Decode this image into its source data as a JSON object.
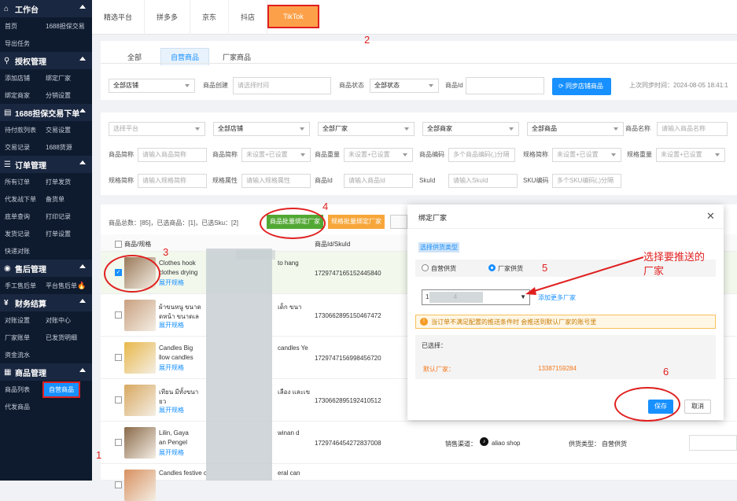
{
  "sidebar": {
    "sections": [
      {
        "title": "工作台",
        "icon": "home-icon",
        "rows": [
          [
            "首页",
            "1688担保交易"
          ],
          [
            "导出任务",
            ""
          ]
        ]
      },
      {
        "title": "授权管理",
        "icon": "user-icon",
        "rows": [
          [
            "添加店铺",
            "绑定厂家"
          ],
          [
            "绑定商家",
            "分销设置"
          ]
        ]
      },
      {
        "title": "1688担保交易下单",
        "icon": "order-icon",
        "rows": [
          [
            "待付款列表",
            "交易设置"
          ],
          [
            "交易记录",
            "1688货源"
          ]
        ]
      },
      {
        "title": "订单管理",
        "icon": "list-icon",
        "rows": [
          [
            "所有订单",
            "打单发货"
          ],
          [
            "代发战下单",
            "备货单"
          ],
          [
            "底单查询",
            "打印记录"
          ],
          [
            "发货记录",
            "打单设置"
          ],
          [
            "快递对账",
            ""
          ]
        ]
      },
      {
        "title": "售后管理",
        "icon": "headset-icon",
        "rows": [
          [
            "手工售后单",
            "平台售后单"
          ]
        ]
      },
      {
        "title": "财务结算",
        "icon": "yen-icon",
        "rows": [
          [
            "对账设置",
            "对账中心"
          ],
          [
            "厂家账单",
            "已发货明细"
          ],
          [
            "资金流水",
            ""
          ]
        ]
      },
      {
        "title": "商品管理",
        "icon": "grid-icon",
        "rows": [
          [
            "商品列表",
            "自营商品"
          ],
          [
            "代发商品",
            ""
          ]
        ]
      }
    ]
  },
  "top_tabs": [
    "精选平台",
    "拼多多",
    "京东",
    "抖店",
    "TikTok"
  ],
  "sub_tabs": [
    "全部",
    "自营商品",
    "厂家商品"
  ],
  "filter1": {
    "store_select": "全部店铺",
    "create_label": "商品创建",
    "create_placeholder": "请选择时间",
    "status_label": "商品状态",
    "status_select": "全部状态",
    "id_label": "商品Id",
    "sync_button": "同步店铺商品",
    "last_sync": "上次同步时间：2024-08-05 18:41:1"
  },
  "filter2": {
    "selects_row1": [
      "选择平台",
      "全部店铺",
      "全部厂家",
      "全部商家",
      "全部商品"
    ],
    "name_label": "商品名称",
    "name_placeholder": "请输入商品名称",
    "row2": [
      {
        "label": "商品简称",
        "placeholder": "请输入商品简称"
      },
      {
        "label": "商品简称",
        "placeholder": "未设置+已设置"
      },
      {
        "label": "商品重量",
        "placeholder": "未设置+已设置"
      },
      {
        "label": "商品编码",
        "placeholder": "多个商品编码(,)分隔"
      },
      {
        "label": "规格简称",
        "placeholder": "未设置+已设置"
      },
      {
        "label": "规格重量",
        "placeholder": "未设置+已设置"
      }
    ],
    "row3": [
      {
        "label": "规格简称",
        "placeholder": "请输入规格简称"
      },
      {
        "label": "规格属性",
        "placeholder": "请输入规格属性"
      },
      {
        "label": "商品Id",
        "placeholder": "请输入商品Id"
      },
      {
        "label": "SkuId",
        "placeholder": "请输入SkuId"
      },
      {
        "label": "SKU编码",
        "placeholder": "多个SKU编码(,)分隔"
      }
    ]
  },
  "list": {
    "summary": "商品总数：[85]，已选商品：[1]，已选Sku：[2]",
    "bind_goods_button": "商品批量绑定厂家",
    "bind_sku_button": "规格批量绑定厂家",
    "col_product": "商品/规格",
    "col_id": "商品Id/SkuId",
    "expand": "展开规格",
    "rows": [
      {
        "title1": "Clothes hook",
        "title1b": "to hang",
        "title2": "clothes drying",
        "id": "1729747165152445840",
        "checked": true
      },
      {
        "title1": "ผ้าขนหนู ขนาด",
        "title1b": "เด็ก ขนา",
        "title2": "ดหน้า ขนาดเล",
        "id": "1730662895150467472",
        "checked": false
      },
      {
        "title1": "Candles Big",
        "title1b": "candles Ye",
        "title2": "llow candles",
        "id": "1729747156998456720",
        "checked": false
      },
      {
        "title1": "เทียน มีทั้งขนา",
        "title1b": "เลือง และเข",
        "title2": "ยว",
        "id": "1730662895192410512",
        "checked": false
      },
      {
        "title1": "Lilin, Gaya",
        "title1b": "winan d",
        "title2": "an Pengel",
        "id": "1729746454272837008",
        "checked": false,
        "channel_label": "销售渠道：",
        "channel": "aliao shop",
        "supply_label": "供货类型：",
        "supply": "自营供货"
      },
      {
        "title1": "Candles festive c",
        "title1b": "eral can",
        "title2": "",
        "id": "",
        "checked": false
      }
    ]
  },
  "modal": {
    "title": "绑定厂家",
    "supply_type_label": "选择供货类型",
    "option_self": "自营供货",
    "option_factory": "厂家供货",
    "factory_select": "1              4",
    "add_more": "添加更多厂家",
    "warning": "当订单不满足配置的推送条件时 会推送到默认厂家的账号里",
    "selected_label": "已选择：",
    "default_factory_label": "默认厂家：",
    "default_factory_value": "13387159284",
    "save": "保存",
    "cancel": "取消"
  },
  "annotations": {
    "n1": "1",
    "n2": "2",
    "n3": "3",
    "n4": "4",
    "n5": "5",
    "n6": "6",
    "note_line1": "选择要推送的",
    "note_line2": "厂家"
  },
  "colors": {
    "accent": "#1890ff",
    "sidebar": "#0e1a2e",
    "tiktok_tab": "#fca14a",
    "annotation": "#e02020",
    "green_btn": "#52a834"
  }
}
